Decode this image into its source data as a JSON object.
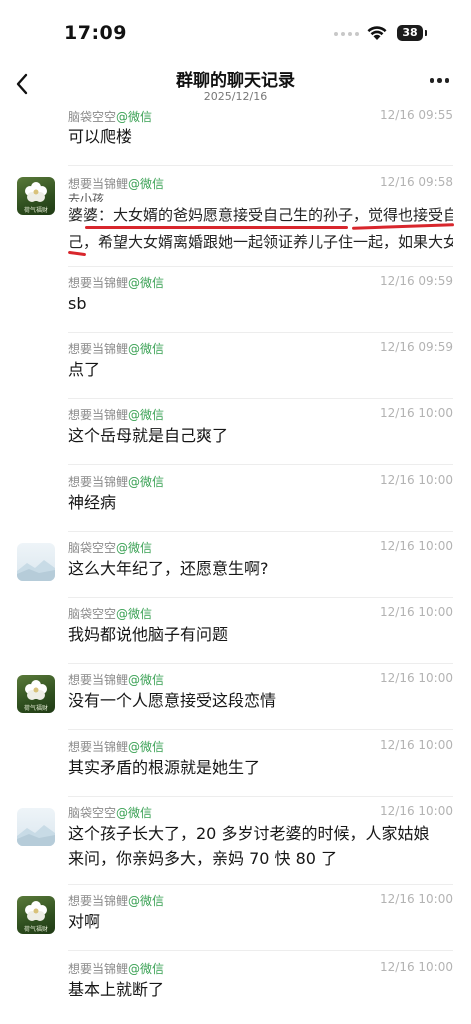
{
  "status_bar": {
    "time": "17:09",
    "battery": "38"
  },
  "nav": {
    "title": "群聊的聊天记录",
    "date": "2025/12/16"
  },
  "messages": [
    {
      "sender": "脑袋空空",
      "source": "@微信",
      "time": "12/16 09:55",
      "text": "可以爬楼",
      "avatar": "none"
    },
    {
      "sender": "想要当锦鲤",
      "source": "@微信",
      "time": "12/16 09:58",
      "quote_cut": "去小孩",
      "quote_line1": "婆婆：大女婿的爸妈愿意接受自己生的孙子，觉得也接受自",
      "quote_line2": "己，希望大女婿离婚跟她一起领证养儿子住一起，如果大女",
      "avatar": "flower",
      "avatar_caption": "荷气福财"
    },
    {
      "sender": "想要当锦鲤",
      "source": "@微信",
      "time": "12/16 09:59",
      "text": "sb",
      "avatar": "none"
    },
    {
      "sender": "想要当锦鲤",
      "source": "@微信",
      "time": "12/16 09:59",
      "text": "点了",
      "avatar": "none"
    },
    {
      "sender": "想要当锦鲤",
      "source": "@微信",
      "time": "12/16 10:00",
      "text": "这个岳母就是自己爽了",
      "avatar": "none"
    },
    {
      "sender": "想要当锦鲤",
      "source": "@微信",
      "time": "12/16 10:00",
      "text": "神经病",
      "avatar": "none"
    },
    {
      "sender": "脑袋空空",
      "source": "@微信",
      "time": "12/16 10:00",
      "text": "这么大年纪了，还愿意生啊?",
      "avatar": "landscape"
    },
    {
      "sender": "脑袋空空",
      "source": "@微信",
      "time": "12/16 10:00",
      "text": "我妈都说他脑子有问题",
      "avatar": "none"
    },
    {
      "sender": "想要当锦鲤",
      "source": "@微信",
      "time": "12/16 10:00",
      "text": "没有一个人愿意接受这段恋情",
      "avatar": "flower",
      "avatar_caption": "荷气福财"
    },
    {
      "sender": "想要当锦鲤",
      "source": "@微信",
      "time": "12/16 10:00",
      "text": "其实矛盾的根源就是她生了",
      "avatar": "none"
    },
    {
      "sender": "脑袋空空",
      "source": "@微信",
      "time": "12/16 10:00",
      "text_line1": "这个孩子长大了，20 多岁讨老婆的时候，人家姑娘",
      "text_line2": "来问，你亲妈多大，亲妈 70 快 80 了",
      "avatar": "landscape"
    },
    {
      "sender": "想要当锦鲤",
      "source": "@微信",
      "time": "12/16 10:00",
      "text": "对啊",
      "avatar": "flower",
      "avatar_caption": "荷气福财"
    },
    {
      "sender": "想要当锦鲤",
      "source": "@微信",
      "time": "12/16 10:00",
      "text": "基本上就断了",
      "avatar": "none"
    }
  ]
}
